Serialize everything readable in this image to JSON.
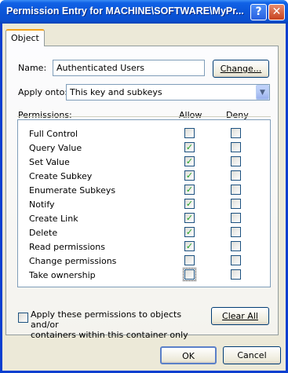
{
  "window": {
    "title": "Permission Entry for MACHINE\\SOFTWARE\\MyPr...",
    "help_glyph": "?",
    "close_glyph": "✕"
  },
  "tabs": [
    {
      "label": "Object"
    }
  ],
  "name_row": {
    "label_pre": "Name:",
    "value": "Authenticated Users",
    "change_button_label": "Change..."
  },
  "apply_onto": {
    "label": "Apply onto:",
    "value": "This key and subkeys",
    "arrow_glyph": "▼"
  },
  "permissions_header": {
    "label": "Permissions:",
    "allow": "Allow",
    "deny": "Deny"
  },
  "permissions": [
    {
      "name": "Full Control",
      "allow": "",
      "deny": ""
    },
    {
      "name": "Query Value",
      "allow": "✓",
      "deny": ""
    },
    {
      "name": "Set Value",
      "allow": "✓",
      "deny": ""
    },
    {
      "name": "Create Subkey",
      "allow": "✓",
      "deny": ""
    },
    {
      "name": "Enumerate Subkeys",
      "allow": "✓",
      "deny": ""
    },
    {
      "name": "Notify",
      "allow": "✓",
      "deny": ""
    },
    {
      "name": "Create Link",
      "allow": "✓",
      "deny": ""
    },
    {
      "name": "Delete",
      "allow": "✓",
      "deny": ""
    },
    {
      "name": "Read permissions",
      "allow": "✓",
      "deny": ""
    },
    {
      "name": "Change permissions",
      "allow": "",
      "deny": ""
    },
    {
      "name": "Take ownership",
      "allow": "",
      "deny": ""
    }
  ],
  "apply_to_children": {
    "line1": "Apply these permissions to objects and/or",
    "line2": "containers within this container only",
    "checked": false
  },
  "clear_all_button_label": "Clear All",
  "footer": {
    "ok_label": "OK",
    "cancel_label": "Cancel"
  },
  "colors": {
    "titlebar": "#0a55d8",
    "dialog_bg": "#ece9d8",
    "check": "#21a121"
  }
}
